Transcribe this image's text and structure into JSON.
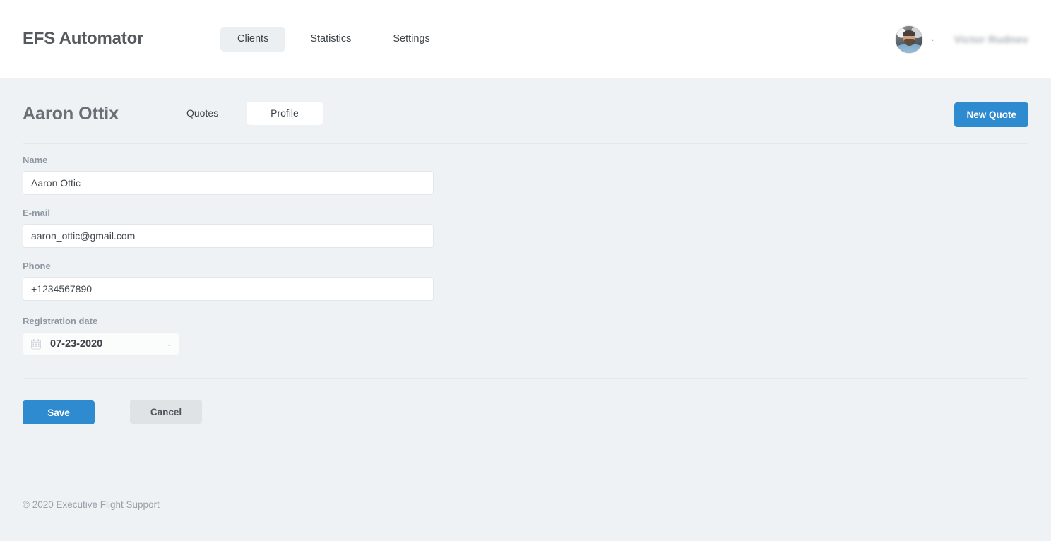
{
  "header": {
    "brand": "EFS Automator",
    "nav": [
      {
        "label": "Clients",
        "active": true
      },
      {
        "label": "Statistics",
        "active": false
      },
      {
        "label": "Settings",
        "active": false
      }
    ],
    "user": {
      "name": "Victor Rudnev",
      "avatar_alt": "user-avatar-photo",
      "chevron": "⌄"
    }
  },
  "page": {
    "title": "Aaron Ottix",
    "tabs": [
      {
        "label": "Quotes",
        "active": false
      },
      {
        "label": "Profile",
        "active": true
      }
    ],
    "new_quote_label": "New Quote"
  },
  "form": {
    "fields": [
      {
        "label": "Name",
        "value": "Aaron Ottic",
        "placeholder": "Name"
      },
      {
        "label": "E-mail",
        "value": "aaron_ottic@gmail.com",
        "placeholder": "E-mail"
      },
      {
        "label": "Phone",
        "value": "+1234567890",
        "placeholder": "Phone"
      }
    ],
    "registration": {
      "label": "Registration date",
      "value": "07-23-2020",
      "icon": "calendar-icon",
      "chevron": "⌄"
    }
  },
  "actions": {
    "save_label": "Save",
    "cancel_label": "Cancel"
  },
  "footer": {
    "copyright": "© 2020 Executive Flight Support"
  },
  "colors": {
    "accent": "#2e8bd0",
    "background": "#eff2f5",
    "header_background": "#ffffff",
    "input_background": "#ffffff",
    "cancel_background": "#dfe3e6",
    "label_text": "#8d97a2",
    "title_text": "#6b7076"
  }
}
